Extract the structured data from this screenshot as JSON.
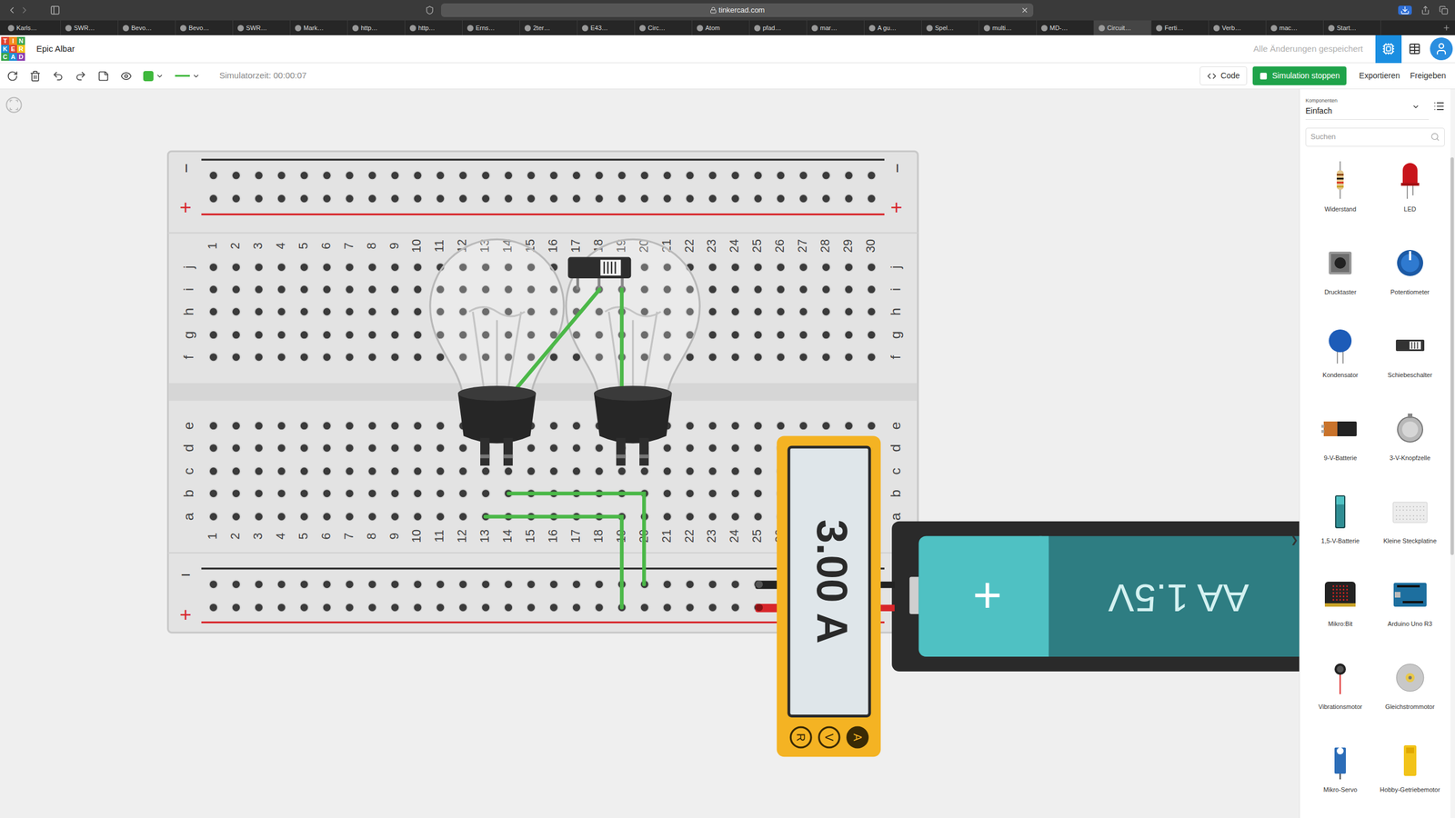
{
  "browser": {
    "url": "tinkercad.com",
    "tabs": [
      {
        "label": "Karls…",
        "selected": false
      },
      {
        "label": "SWR…",
        "selected": false
      },
      {
        "label": "Bevo…",
        "selected": false
      },
      {
        "label": "Bevo…",
        "selected": false
      },
      {
        "label": "SWR…",
        "selected": false
      },
      {
        "label": "Mark…",
        "selected": false
      },
      {
        "label": "http…",
        "selected": false
      },
      {
        "label": "http…",
        "selected": false
      },
      {
        "label": "Erns…",
        "selected": false
      },
      {
        "label": "2ter…",
        "selected": false
      },
      {
        "label": "E43…",
        "selected": false
      },
      {
        "label": "Circ…",
        "selected": false
      },
      {
        "label": "Atom",
        "selected": false
      },
      {
        "label": "pfad…",
        "selected": false
      },
      {
        "label": "mar…",
        "selected": false
      },
      {
        "label": "A gu…",
        "selected": false
      },
      {
        "label": "Spel…",
        "selected": false
      },
      {
        "label": "multi…",
        "selected": false
      },
      {
        "label": "MD-…",
        "selected": false
      },
      {
        "label": "Circuit…",
        "selected": true
      },
      {
        "label": "Ferti…",
        "selected": false
      },
      {
        "label": "Verb…",
        "selected": false
      },
      {
        "label": "mac…",
        "selected": false
      },
      {
        "label": "Start…",
        "selected": false
      }
    ]
  },
  "app": {
    "logo": [
      "T",
      "I",
      "N",
      "K",
      "E",
      "R",
      "C",
      "A",
      "D"
    ],
    "project": "Epic Albar",
    "save_status": "Alle Änderungen gespeichert"
  },
  "toolbar": {
    "sim_time": "Simulatorzeit: 00:00:07",
    "code": "Code",
    "simulate": "Simulation stoppen",
    "export": "Exportieren",
    "share": "Freigeben"
  },
  "panel": {
    "caption": "Komponenten",
    "category": "Einfach",
    "search_placeholder": "Suchen",
    "collapse": "❯",
    "parts": [
      {
        "label": "Widerstand",
        "kind": "resistor"
      },
      {
        "label": "LED",
        "kind": "led"
      },
      {
        "label": "Drucktaster",
        "kind": "button"
      },
      {
        "label": "Potentiometer",
        "kind": "potentiometer"
      },
      {
        "label": "Kondensator",
        "kind": "capacitor"
      },
      {
        "label": "Schiebeschalter",
        "kind": "switch"
      },
      {
        "label": "9-V-Batterie",
        "kind": "battery9v"
      },
      {
        "label": "3-V-Knopfzelle",
        "kind": "coincell"
      },
      {
        "label": "1,5-V-Batterie",
        "kind": "battery15"
      },
      {
        "label": "Kleine Steckplatine",
        "kind": "breadboard"
      },
      {
        "label": "Mikro:Bit",
        "kind": "microbit"
      },
      {
        "label": "Arduino Uno R3",
        "kind": "arduino"
      },
      {
        "label": "Vibrationsmotor",
        "kind": "vibration"
      },
      {
        "label": "Gleichstrommotor",
        "kind": "dcmotor"
      },
      {
        "label": "Mikro-Servo",
        "kind": "servo"
      },
      {
        "label": "Hobby-Getriebemotor",
        "kind": "gearmotor"
      }
    ]
  },
  "breadboard": {
    "columns": [
      "1",
      "2",
      "3",
      "4",
      "5",
      "6",
      "7",
      "8",
      "9",
      "10",
      "11",
      "12",
      "13",
      "14",
      "15",
      "16",
      "17",
      "18",
      "19",
      "20",
      "21",
      "22",
      "23",
      "24",
      "25",
      "26",
      "27",
      "28",
      "29",
      "30"
    ],
    "rows_top": [
      "j",
      "i",
      "h",
      "g",
      "f"
    ],
    "rows_bottom": [
      "e",
      "d",
      "c",
      "b",
      "a"
    ],
    "rail_minus": "−",
    "rail_plus": "+"
  },
  "circuit": {
    "switch": {
      "on": true
    },
    "multimeter": {
      "reading": "3.00 A",
      "modes": [
        {
          "label": "R",
          "selected": false
        },
        {
          "label": "V",
          "selected": false
        },
        {
          "label": "A",
          "selected": true
        }
      ]
    },
    "battery": {
      "label": "AA 1.5V",
      "plus": "+"
    }
  }
}
